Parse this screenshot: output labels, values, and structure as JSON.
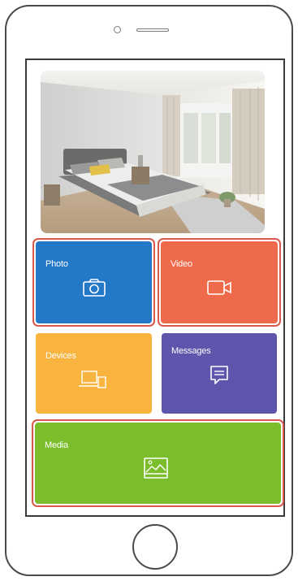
{
  "tiles": {
    "photo": {
      "label": "Photo",
      "color": "#2478c8",
      "icon": "camera-icon"
    },
    "video": {
      "label": "Video",
      "color": "#ef6a4b",
      "icon": "video-camera-icon"
    },
    "devices": {
      "label": "Devices",
      "color": "#f9b33f",
      "icon": "devices-icon"
    },
    "messages": {
      "label": "Messages",
      "color": "#5e55ad",
      "icon": "chat-bubble-icon"
    },
    "media": {
      "label": "Media",
      "color": "#7cbd2c",
      "icon": "image-icon"
    }
  },
  "hero_image": {
    "subject": "bedroom-photo"
  },
  "highlight_color": "#d9584a"
}
